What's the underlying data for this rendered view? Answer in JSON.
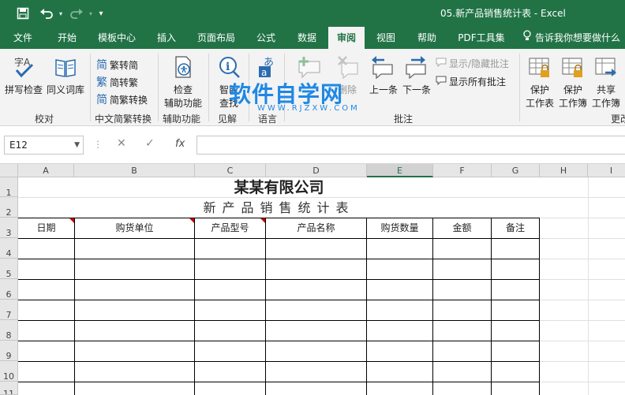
{
  "titlebar": {
    "document_title": "05.新产品销售统计表  -  Excel",
    "save_icon": "save-icon",
    "undo_icon": "undo-icon",
    "redo_icon": "redo-icon",
    "customize_icon": "customize-quick-access-icon"
  },
  "tabs": [
    {
      "label": "文件",
      "active": false
    },
    {
      "label": "开始",
      "active": false
    },
    {
      "label": "模板中心",
      "active": false
    },
    {
      "label": "插入",
      "active": false
    },
    {
      "label": "页面布局",
      "active": false
    },
    {
      "label": "公式",
      "active": false
    },
    {
      "label": "数据",
      "active": false
    },
    {
      "label": "审阅",
      "active": true
    },
    {
      "label": "视图",
      "active": false
    },
    {
      "label": "帮助",
      "active": false
    },
    {
      "label": "PDF工具集",
      "active": false
    }
  ],
  "tellme": "告诉我你想要做什么",
  "ribbon": {
    "proofing": {
      "spell": "拼写检查",
      "thesaurus": "同义词库",
      "group": "校对"
    },
    "chinese": {
      "trad": "繁转简",
      "simp": "简转繁",
      "convert": "简繁转换",
      "group": "中文简繁转换"
    },
    "accessibility": {
      "check_line1": "检查",
      "check_line2": "辅助功能",
      "group": "辅助功能"
    },
    "insights": {
      "smart_line1": "智能",
      "smart_line2": "查找",
      "group": "见解"
    },
    "language": {
      "group": "语言"
    },
    "comments": {
      "delete": "删除",
      "prev": "上一条",
      "next": "下一条",
      "show_hide": "显示/隐藏批注",
      "show_all": "显示所有批注",
      "group": "批注"
    },
    "protect": {
      "sheet_line1": "保护",
      "sheet_line2": "工作表",
      "book_line1": "保护",
      "book_line2": "工作簿",
      "share_line1": "共享",
      "share_line2": "工作簿",
      "group": "更改"
    }
  },
  "watermark": {
    "main": "软件自学网",
    "sub": "WWW.RJZXW.COM"
  },
  "formula_bar": {
    "name_box": "E12",
    "fx": "fx",
    "value": ""
  },
  "sheet": {
    "columns": [
      "A",
      "B",
      "C",
      "D",
      "E",
      "F",
      "G",
      "H",
      "I"
    ],
    "selected_column": "E",
    "rows": [
      "1",
      "2",
      "3",
      "4",
      "5",
      "6",
      "7",
      "8",
      "9",
      "10",
      "11"
    ],
    "company": "某某有限公司",
    "subtitle": "新产品销售统计表",
    "headers": [
      "日期",
      "购货单位",
      "产品型号",
      "产品名称",
      "购货数量",
      "金额",
      "备注"
    ]
  },
  "colors": {
    "accent": "#217346",
    "comment_marker": "#cc0000",
    "watermark": "#1e88e5"
  }
}
